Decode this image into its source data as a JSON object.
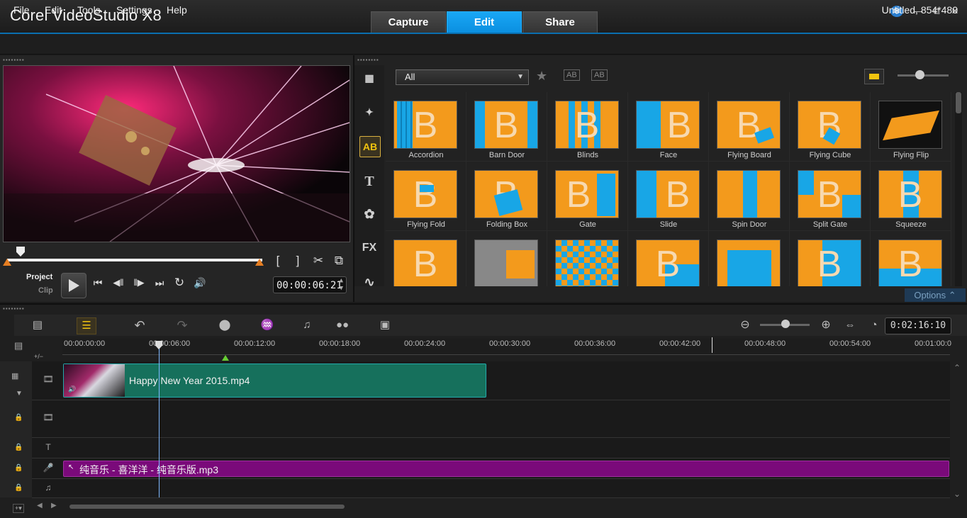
{
  "app": {
    "title": "Corel VideoStudio X8"
  },
  "main_tabs": [
    {
      "label": "Capture"
    },
    {
      "label": "Edit"
    },
    {
      "label": "Share"
    }
  ],
  "window_controls": {
    "special": "❄",
    "minimize": "—",
    "restore": "⧉",
    "close": "✕"
  },
  "menu": [
    {
      "label": "File"
    },
    {
      "label": "Edit"
    },
    {
      "label": "Tools"
    },
    {
      "label": "Settings"
    },
    {
      "label": "Help"
    }
  ],
  "project_info": "Untitled, 854*480",
  "player": {
    "mode_project": "Project",
    "mode_clip": "Clip",
    "timecode": "00:00:06:21",
    "controls": {
      "play": "▶",
      "home": "⏮",
      "prev": "◀‖",
      "next": "‖▶",
      "end": "⏭",
      "repeat": "↻",
      "volume": "🔊",
      "mark_in": "[",
      "mark_out": "]",
      "cut": "✂",
      "enlarge": "⧉"
    }
  },
  "library": {
    "category": "All",
    "sidebar": [
      {
        "name": "media-icon",
        "glyph": "▦"
      },
      {
        "name": "instant-project-icon",
        "glyph": "✦"
      },
      {
        "name": "transition-icon",
        "glyph": "AB"
      },
      {
        "name": "title-icon",
        "glyph": "T"
      },
      {
        "name": "graphic-icon",
        "glyph": "✿"
      },
      {
        "name": "filter-icon",
        "glyph": "FX"
      },
      {
        "name": "path-icon",
        "glyph": "∿"
      }
    ],
    "items": [
      {
        "label": "Accordion"
      },
      {
        "label": "Barn Door"
      },
      {
        "label": "Blinds"
      },
      {
        "label": "Face"
      },
      {
        "label": "Flying Board"
      },
      {
        "label": "Flying Cube"
      },
      {
        "label": "Flying Flip"
      },
      {
        "label": "Flying Fold"
      },
      {
        "label": "Folding Box"
      },
      {
        "label": "Gate"
      },
      {
        "label": "Slide"
      },
      {
        "label": "Spin Door"
      },
      {
        "label": "Split Gate"
      },
      {
        "label": "Squeeze"
      },
      {
        "label": ""
      },
      {
        "label": ""
      },
      {
        "label": ""
      },
      {
        "label": ""
      },
      {
        "label": ""
      },
      {
        "label": ""
      },
      {
        "label": ""
      }
    ],
    "options_label": "Options ⌃"
  },
  "timeline": {
    "total_time": "0:02:16:10",
    "ruler": [
      "00:00:00:00",
      "00:00:06:00",
      "00:00:12:00",
      "00:00:18:00",
      "00:00:24:00",
      "00:00:30:00",
      "00:00:36:00",
      "00:00:42:00",
      "00:00:48:00",
      "00:00:54:00",
      "00:01:00:0"
    ],
    "video_clip": "Happy New Year 2015.mp4",
    "music_clip": "纯音乐 - 喜洋洋 - 纯音乐版.mp3",
    "add_remove_label": "+/−"
  }
}
